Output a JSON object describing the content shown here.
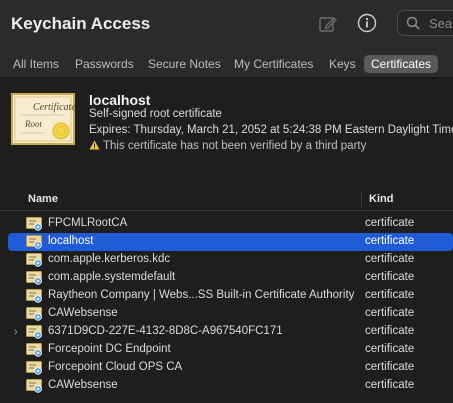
{
  "window": {
    "title": "Keychain Access",
    "search_placeholder": "Sear"
  },
  "tabs": [
    {
      "label": "All Items",
      "active": false
    },
    {
      "label": "Passwords",
      "active": false
    },
    {
      "label": "Secure Notes",
      "active": false
    },
    {
      "label": "My Certificates",
      "active": false
    },
    {
      "label": "Keys",
      "active": false
    },
    {
      "label": "Certificates",
      "active": true
    }
  ],
  "detail": {
    "name": "localhost",
    "subtitle": "Self-signed root certificate",
    "expires": "Expires: Thursday, March 21, 2052 at 5:24:38 PM Eastern Daylight Time",
    "warning": "This certificate has not been verified by a third party",
    "image_text_1": "Certificate",
    "image_text_2": "Root"
  },
  "table": {
    "columns": {
      "name": "Name",
      "kind": "Kind"
    },
    "rows": [
      {
        "name": "FPCMLRootCA",
        "kind": "certificate",
        "selected": false,
        "expandable": false
      },
      {
        "name": "localhost",
        "kind": "certificate",
        "selected": true,
        "expandable": false
      },
      {
        "name": "com.apple.kerberos.kdc",
        "kind": "certificate",
        "selected": false,
        "expandable": false
      },
      {
        "name": "com.apple.systemdefault",
        "kind": "certificate",
        "selected": false,
        "expandable": false
      },
      {
        "name": "Raytheon Company | Webs...SS Built-in Certificate Authority",
        "kind": "certificate",
        "selected": false,
        "expandable": false
      },
      {
        "name": "CAWebsense",
        "kind": "certificate",
        "selected": false,
        "expandable": false
      },
      {
        "name": "6371D9CD-227E-4132-8D8C-A967540FC171",
        "kind": "certificate",
        "selected": false,
        "expandable": true
      },
      {
        "name": "Forcepoint DC Endpoint",
        "kind": "certificate",
        "selected": false,
        "expandable": false
      },
      {
        "name": "Forcepoint Cloud OPS CA",
        "kind": "certificate",
        "selected": false,
        "expandable": false
      },
      {
        "name": "CAWebsense",
        "kind": "certificate",
        "selected": false,
        "expandable": false
      }
    ]
  },
  "colors": {
    "selection": "#1f5bd6",
    "background": "#1e1e1e",
    "toolbar": "#2b2b2b",
    "active_tab": "#5a5a5a"
  },
  "icons": {
    "compose": "compose-icon",
    "info": "info-icon",
    "search": "search-icon",
    "warning": "warning-icon",
    "certificate": "certificate-icon",
    "expand": "chevron-right-icon"
  }
}
